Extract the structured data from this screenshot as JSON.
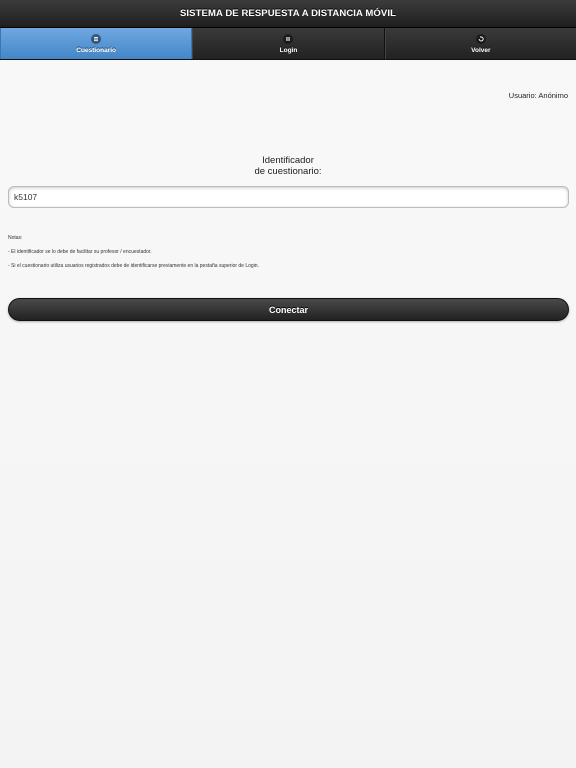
{
  "header": {
    "title": "SISTEMA DE RESPUESTA A DISTANCIA MÓVIL"
  },
  "nav": {
    "tabs": [
      {
        "label": "Cuestionario",
        "icon": "list-icon",
        "active": true
      },
      {
        "label": "Login",
        "icon": "pause-icon",
        "active": false
      },
      {
        "label": "Volver",
        "icon": "back-arrow-icon",
        "active": false
      }
    ]
  },
  "user": {
    "text": "Usuario: Anónimo"
  },
  "form": {
    "label_line1": "Identificador",
    "label_line2": "de cuestionario:",
    "input_value": "k5107"
  },
  "notes": {
    "title": "Notas:",
    "items": [
      "- El identificador se lo debe de facilitar su profesor / encuestador.",
      "- Si el cuestionario utiliza usuarios registrados debe de identificarse previamente en la pestaña superior de Login."
    ]
  },
  "actions": {
    "connect_label": "Conectar"
  },
  "colors": {
    "active_tab": "#5a97d4",
    "bar_dark": "#2a2a2a",
    "background": "#f6f6f6"
  }
}
